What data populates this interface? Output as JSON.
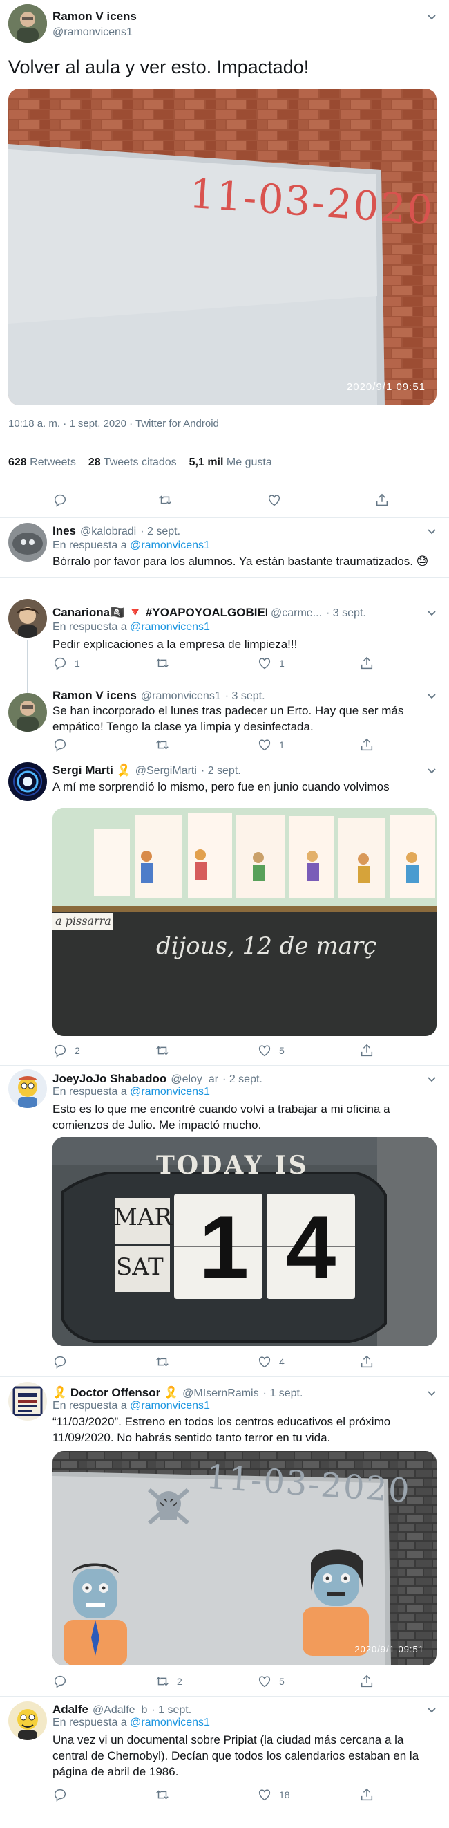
{
  "main_tweet": {
    "author_name": "Ramon V icens",
    "author_handle": "@ramonvicens1",
    "text": "Volver al aula y ver esto. Impactado!",
    "photo_stamp": "2020/9/1  09:51",
    "board_date": "11-03-2020",
    "meta": "10:18 a. m. · 1 sept. 2020 · Twitter for Android",
    "stats": {
      "retweets_value": "628",
      "retweets_label": "Retweets",
      "quotes_value": "28",
      "quotes_label": "Tweets citados",
      "likes_value": "5,1 mil",
      "likes_label": "Me gusta"
    }
  },
  "reply_prefix": "En respuesta a",
  "replies": [
    {
      "name": "Ines",
      "handle": "@kalobradi",
      "date": "· 2 sept.",
      "reply_to": "@ramonvicens1",
      "text": "Bórralo por favor para los alumnos. Ya están bastante traumatizados. 😓"
    },
    {
      "name": "Canariona🏴‍☠️ 🔻 #YOAPOYOALGOBIERNO 🔻",
      "handle": "@carme...",
      "date": "· 3 sept.",
      "reply_to": "@ramonvicens1",
      "text": "Pedir explicaciones a la empresa de limpieza!!!",
      "replies": "1",
      "retweets": "",
      "likes": "1"
    },
    {
      "name": "Ramon V icens",
      "handle": "@ramonvicens1",
      "date": "· 3 sept.",
      "text": "Se han incorporado el lunes tras  padecer un Erto. Hay que ser más empático! Tengo la clase ya limpia y desinfectada.",
      "likes": "1"
    },
    {
      "name": "Sergi Martí 🎗️",
      "handle": "@SergiMarti",
      "date": "· 2 sept.",
      "text": "A mí me sorprendió lo mismo, pero fue en junio cuando volvimos",
      "board_text": "dijous, 12 de març",
      "label_text": "a pissarra",
      "replies": "2",
      "likes": "5"
    },
    {
      "name": "JoeyJoJo Shabadoo",
      "handle": "@eloy_ar",
      "date": "· 2 sept.",
      "reply_to": "@ramonvicens1",
      "text": "Esto es lo que me encontré cuando volví a trabajar a mi oficina a comienzos de Julio. Me impactó mucho.",
      "sign": "TODAY IS",
      "month": "MAR",
      "day": "SAT",
      "digit1": "1",
      "digit2": "4",
      "likes": "4"
    },
    {
      "name": "🎗️ Doctor Offensor 🎗️",
      "handle": "@MIsernRamis",
      "date": "· 1 sept.",
      "reply_to": "@ramonvicens1",
      "text": "“11/03/2020”. Estreno en todos los centros educativos el próximo 11/09/2020. No habrás sentido tanto terror en tu vida.",
      "board_date": "11-03-2020",
      "photo_stamp": "2020/9/1  09:51",
      "retweets": "2",
      "likes": "5"
    },
    {
      "name": "Adalfe",
      "handle": "@Adalfe_b",
      "date": "· 1 sept.",
      "reply_to": "@ramonvicens1",
      "text": "Una vez vi un documental sobre Pripiat (la ciudad más cercana a la central de Chernobyl). Decían que todos los calendarios estaban en la página de abril de 1986.",
      "likes": "18"
    }
  ],
  "colors": {
    "text": "#14171a",
    "muted": "#657786",
    "link": "#1b95e0",
    "divider": "#e6ecf0"
  }
}
